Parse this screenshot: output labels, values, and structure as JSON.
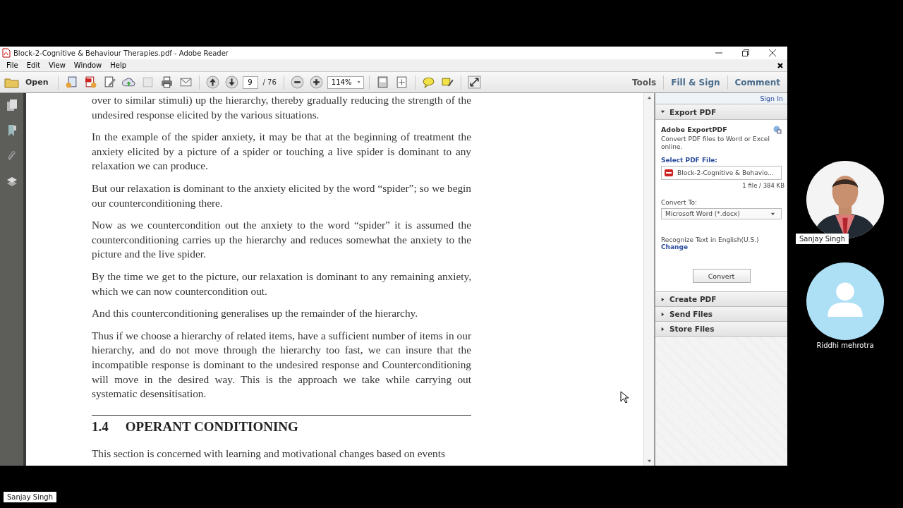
{
  "window": {
    "title": "Block-2-Cognitive & Behaviour Therapies.pdf - Adobe Reader"
  },
  "menu": [
    "File",
    "Edit",
    "View",
    "Window",
    "Help"
  ],
  "toolbar": {
    "open": "Open",
    "page": "9",
    "total": "/ 76",
    "zoom": "114%",
    "tabs": [
      "Tools",
      "Fill & Sign",
      "Comment"
    ]
  },
  "document": [
    {
      "kind": "paragraph",
      "text": "over to similar stimuli) up the hierarchy, thereby gradually reducing the strength of the undesired response elicited by the various situations."
    },
    {
      "kind": "paragraph",
      "text": "In the example of the spider anxiety, it may be that at the beginning of treatment the anxiety elicited by a picture of a spider or touching a live spider is dominant to any relaxation we can produce."
    },
    {
      "kind": "paragraph",
      "text": "But our relaxation is dominant to the anxiety elicited by the word “spider”; so we begin our counterconditioning there."
    },
    {
      "kind": "paragraph",
      "text": "Now as we countercondition out the anxiety to the word “spider” it is assumed the counterconditioning carries up the hierarchy and reduces somewhat the anxiety to the picture and the live spider."
    },
    {
      "kind": "paragraph",
      "text": "By the time we get to the picture, our relaxation is dominant to any remaining anxiety, which we can now countercondition out."
    },
    {
      "kind": "paragraph",
      "text": "And this counterconditioning generalises up the remainder of the hierarchy."
    },
    {
      "kind": "paragraph",
      "text": "Thus if we choose a hierarchy of related items, have a sufficient number of items in our hierarchy, and do not move through the hierarchy too fast, we can insure that the incompatible response is dominant to the undesired response and Counterconditioning will move in the desired way. This is the approach we take while carrying out systematic desensitisation."
    },
    {
      "kind": "heading",
      "number": "1.4",
      "text": "OPERANT CONDITIONING"
    },
    {
      "kind": "paragraph",
      "text": "This section is concerned with learning and motivational changes based on events"
    }
  ],
  "panel": {
    "sign_in": "Sign In",
    "export": {
      "title": "Export PDF",
      "expanded": true,
      "heading": "Adobe ExportPDF",
      "description": "Convert PDF files to Word or Excel online.",
      "select_label": "Select PDF File:",
      "file": "Block-2-Cognitive & Behavio...",
      "file_info": "1 file / 384 KB",
      "convert_label": "Convert To:",
      "format": "Microsoft Word (*.docx)",
      "recognize": "Recognize Text in English(U.S.)",
      "change": "Change",
      "button": "Convert"
    },
    "sections": [
      {
        "title": "Create PDF",
        "expanded": false
      },
      {
        "title": "Send Files",
        "expanded": false
      },
      {
        "title": "Store Files",
        "expanded": false
      }
    ]
  },
  "participants": [
    {
      "name": "Sanjay Singh"
    },
    {
      "name": "Riddhi mehrotra",
      "kind": "avatar"
    }
  ],
  "presenter": "Sanjay Singh"
}
